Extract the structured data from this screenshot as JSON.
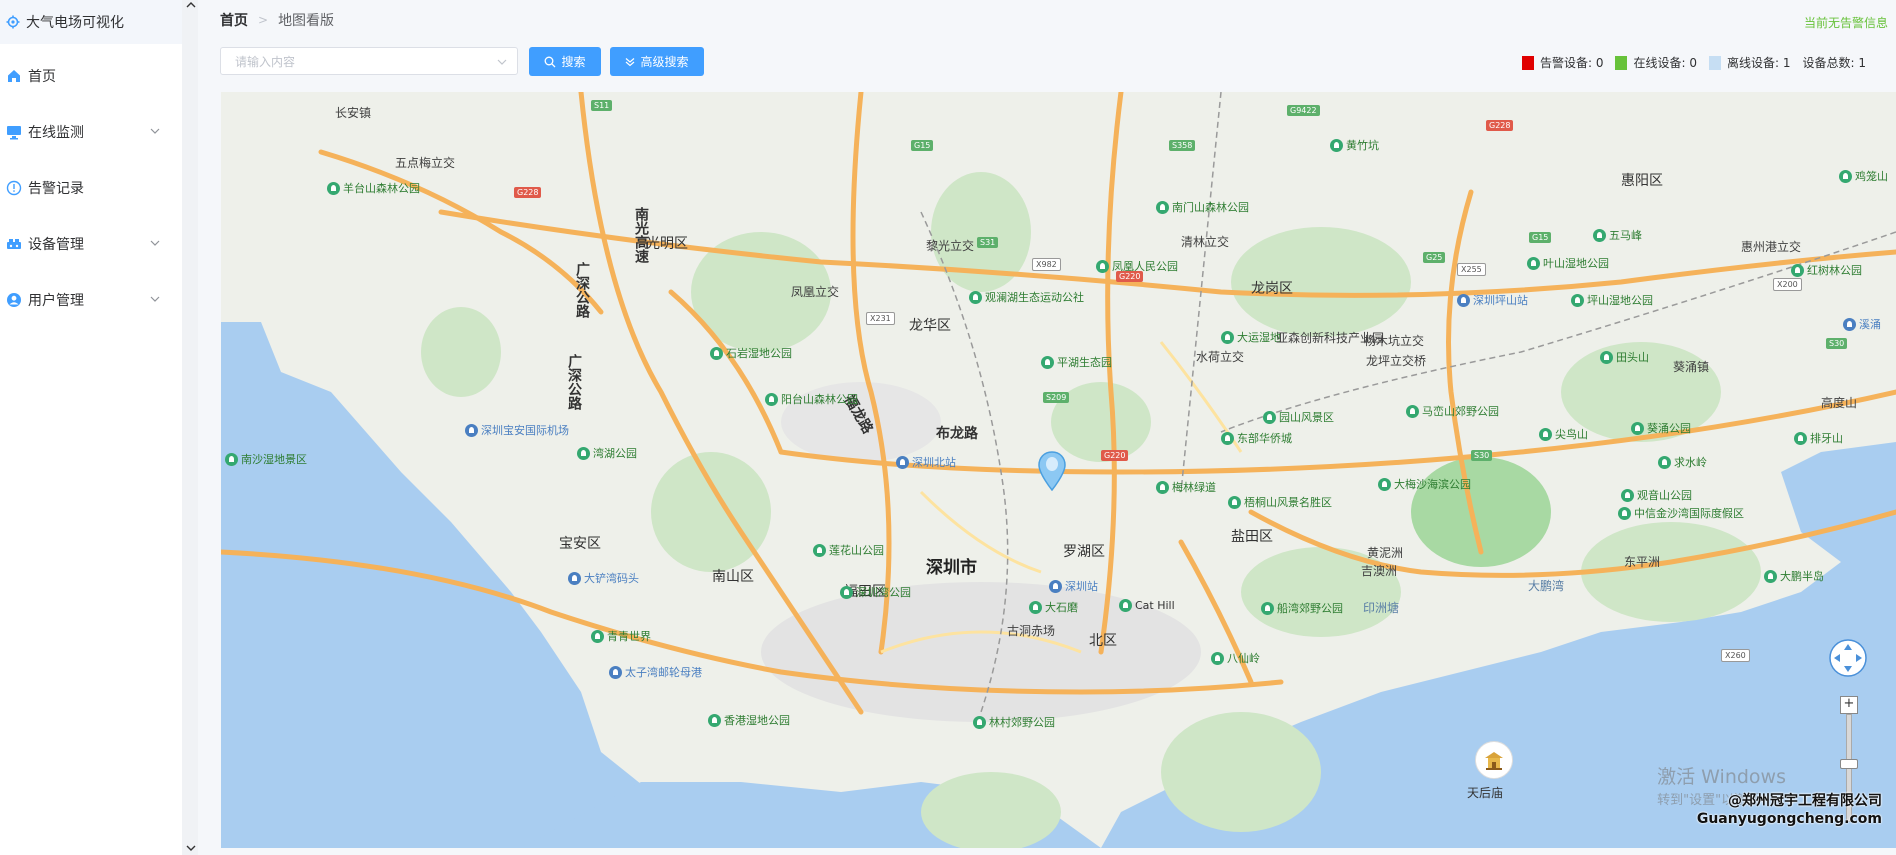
{
  "app": {
    "title": "大气电场可视化"
  },
  "sidebar": {
    "items": [
      {
        "label": "首页",
        "icon": "home-icon"
      },
      {
        "label": "在线监测",
        "icon": "monitor-icon"
      },
      {
        "label": "告警记录",
        "icon": "info-icon"
      },
      {
        "label": "设备管理",
        "icon": "device-icon"
      },
      {
        "label": "用户管理",
        "icon": "user-icon"
      }
    ]
  },
  "breadcrumb": {
    "home": "首页",
    "current": "地图看版"
  },
  "alarm_info": "当前无告警信息",
  "search": {
    "placeholder": "请输入内容",
    "button": "搜索",
    "advanced_button": "高级搜索"
  },
  "legend": {
    "alarm": {
      "label": "告警设备:",
      "count": "0",
      "color": "#e00000"
    },
    "online": {
      "label": "在线设备:",
      "count": "0",
      "color": "#67c23a"
    },
    "offline": {
      "label": "离线设备:",
      "count": "1",
      "color": "#c6def3"
    },
    "total": {
      "label": "设备总数:",
      "count": "1"
    }
  },
  "map": {
    "districts": [
      "光明区",
      "龙华区",
      "龙岗区",
      "惠阳区",
      "宝安区",
      "南山区",
      "福田区",
      "罗湖区",
      "盐田区",
      "北区"
    ],
    "city": "深圳市",
    "roads": [
      "南光高速",
      "广深公路",
      "广深公路",
      "福龙路",
      "布龙路"
    ],
    "places": [
      "石岩湿地公园",
      "阳台山森林公园",
      "羊台山森林公园",
      "长安镇",
      "五点梅立交",
      "观澜湖生态运动公社",
      "平湖生态园",
      "凤凰人民公园",
      "南门山森林公园",
      "清林立交",
      "大运湿地",
      "亚森创新科技产业园",
      "园山风景区",
      "马峦山郊野公园",
      "梧桐山风景名胜区",
      "大梅沙海滨公园",
      "深圳北站",
      "深圳站",
      "深圳湾公园",
      "大鹏半岛",
      "杨木坑立交",
      "龙坪立交桥",
      "水荷立交",
      "东部华侨城",
      "梅林绿道",
      "大石磨",
      "古洞赤场",
      "Cat Hill",
      "八仙岭",
      "船湾郊野公园",
      "印洲塘",
      "黄泥洲",
      "吉澳洲",
      "东平洲",
      "大鹏湾",
      "观音山公园",
      "中信金沙湾国际度假区",
      "深圳宝安国际机场",
      "湾湖公园",
      "大铲湾码头",
      "青青世界",
      "南沙湿地景区",
      "太子湾邮轮母港",
      "香港湿地公园",
      "林村郊野公园",
      "莲花山公园",
      "黎光立交",
      "凤凰立交",
      "黄竹坑",
      "惠州港立交",
      "红树林公园",
      "排牙山",
      "求水岭",
      "葵涌公园",
      "尖鸟山",
      "五马峰",
      "叶山湿地公园",
      "深圳坪山站",
      "坪山湿地公园",
      "田头山",
      "葵涌镇",
      "鸡笼山",
      "高度山",
      "溪涌"
    ],
    "temple": "天后庙"
  },
  "watermark": {
    "line1": "激活 Windows",
    "line2": "转到\"设置\"以激活"
  },
  "company": {
    "line1": "@郑州冠宇工程有限公司",
    "line2": "Guanyugongcheng.com"
  }
}
